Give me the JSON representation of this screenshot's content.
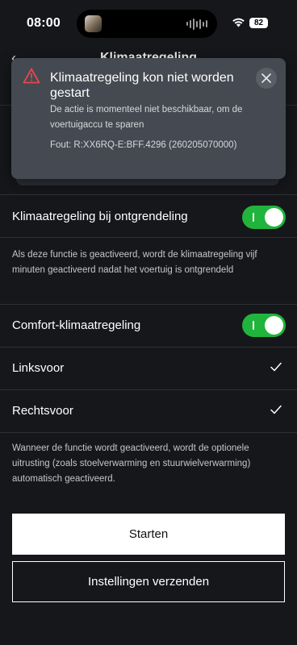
{
  "status_bar": {
    "time": "08:00",
    "battery": "82"
  },
  "header": {
    "title": "Klimaatregeling"
  },
  "alert": {
    "title": "Klimaatregeling kon niet worden gestart",
    "message": "De actie is momenteel niet beschikbaar, om de voertuigaccu te sparen",
    "error_code": "Fout: R:XX6RQ-E:BFF.4296 (260205070000)",
    "icon_color": "#e5484d"
  },
  "settings": {
    "unlock_climate": {
      "label": "Klimaatregeling bij ontgrendeling",
      "enabled": true,
      "description": "Als deze functie is geactiveerd, wordt de klimaatregeling vijf minuten geactiveerd nadat het voertuig is ontgrendeld"
    },
    "comfort_climate": {
      "label": "Comfort-klimaatregeling",
      "enabled": true,
      "options": [
        {
          "label": "Linksvoor",
          "checked": true
        },
        {
          "label": "Rechtsvoor",
          "checked": true
        }
      ],
      "description": "Wanneer de functie wordt geactiveerd, wordt de optionele uitrusting (zoals stoelverwarming en stuurwielverwarming) automatisch geactiveerd."
    }
  },
  "actions": {
    "start_label": "Starten",
    "send_settings_label": "Instellingen verzenden"
  },
  "colors": {
    "toggle_on": "#20b43c",
    "background": "#16171b",
    "dialog": "#454951"
  }
}
